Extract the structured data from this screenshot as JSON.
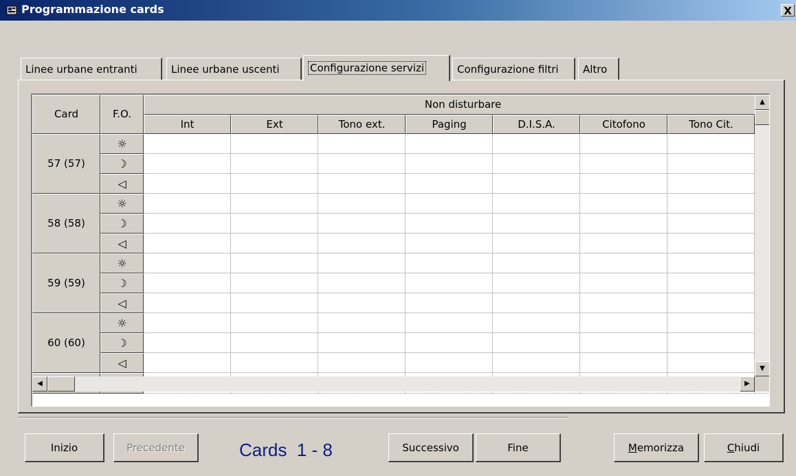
{
  "window": {
    "title": "Programmazione cards",
    "close_label": "X"
  },
  "tabs": [
    {
      "label": "Linee urbane entranti",
      "active": false
    },
    {
      "label": "Linee urbane uscenti",
      "active": false
    },
    {
      "label": "Configurazione servizi",
      "active": true
    },
    {
      "label": "Configurazione filtri",
      "active": false
    },
    {
      "label": "Altro",
      "active": false
    }
  ],
  "grid": {
    "header_card": "Card",
    "header_fo": "F.O.",
    "header_group": "Non disturbare",
    "columns": [
      "Int",
      "Ext",
      "Tono ext.",
      "Paging",
      "D.I.S.A.",
      "Citofono",
      "Tono Cit."
    ],
    "rows": [
      {
        "card": "57 (57)",
        "modes": [
          "sun-icon",
          "moon-icon",
          "speaker-icon"
        ]
      },
      {
        "card": "58 (58)",
        "modes": [
          "sun-icon",
          "moon-icon",
          "speaker-icon"
        ]
      },
      {
        "card": "59 (59)",
        "modes": [
          "sun-icon",
          "moon-icon",
          "speaker-icon"
        ]
      },
      {
        "card": "60 (60)",
        "modes": [
          "sun-icon",
          "moon-icon",
          "speaker-icon"
        ]
      }
    ],
    "mode_glyphs": {
      "sun-icon": "☼",
      "moon-icon": "☽",
      "speaker-icon": "◁"
    }
  },
  "footer": {
    "inizio": "Inizio",
    "precedente": "Precedente",
    "cards_label": "Cards  1 - 8",
    "successivo": "Successivo",
    "fine": "Fine",
    "memorizza": "Memorizza",
    "chiudi": "Chiudi"
  }
}
